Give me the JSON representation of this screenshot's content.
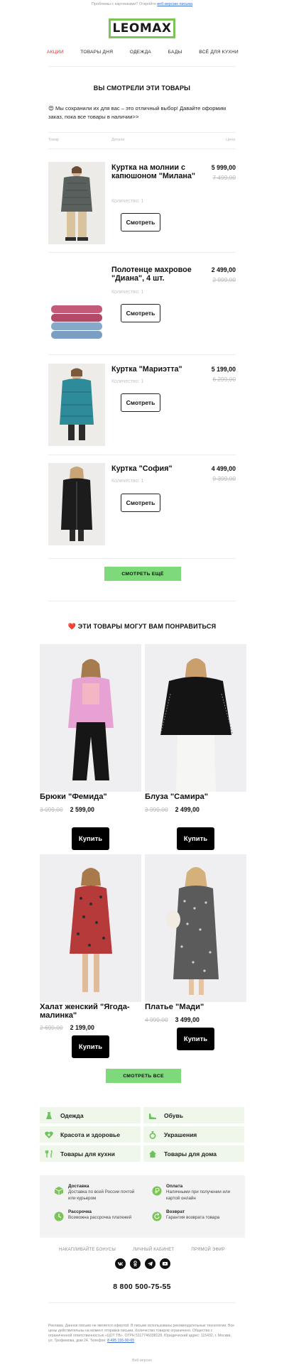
{
  "preheader": {
    "text": "Проблемы с картинками? Откройте",
    "link": "веб-версию письма"
  },
  "logo": {
    "text": "LEOMAX"
  },
  "nav": [
    {
      "label": "АКЦИИ",
      "active": true
    },
    {
      "label": "ТОВАРЫ ДНЯ"
    },
    {
      "label": "ОДЕЖДА"
    },
    {
      "label": "БАДЫ"
    },
    {
      "label": "ВСЁ ДЛЯ КУХНИ"
    }
  ],
  "viewed": {
    "title": "ВЫ СМОТРЕЛИ ЭТИ ТОВАРЫ",
    "intro_emoji": "😍",
    "intro": "Мы сохранили их для вас – это отличный выбор! Давайте оформим заказ, пока все товары в наличии>>",
    "columns": {
      "product": "Товар",
      "details": "Детали",
      "price": "Цена"
    },
    "items": [
      {
        "name": "Куртка на молнии с капюшоном \"Милана\"",
        "qty": "Количество: 1",
        "price": "5 999,00",
        "old_price": "7 499,00",
        "button": "Смотреть"
      },
      {
        "name": "Полотенце махровое \"Диана\", 4 шт.",
        "qty": "Количество: 1",
        "price": "2 499,00",
        "old_price": "2 999,00",
        "button": "Смотреть"
      },
      {
        "name": "Куртка \"Мариэтта\"",
        "qty": "Количество: 1",
        "price": "5 199,00",
        "old_price": "6 299,00",
        "button": "Смотреть"
      },
      {
        "name": "Куртка \"София\"",
        "qty": "Количество: 1",
        "price": "4 499,00",
        "old_price": "9 399,00",
        "button": "Смотреть"
      }
    ],
    "more_button": "СМОТРЕТЬ ЕЩЁ"
  },
  "recommend": {
    "title_emoji": "❤️",
    "title": "ЭТИ ТОВАРЫ МОГУТ ВАМ ПОНРАВИТЬСЯ",
    "items": [
      {
        "name": "Брюки \"Фемида\"",
        "old_price": "3 099,00",
        "price": "2 599,00",
        "button": "Купить"
      },
      {
        "name": "Блуза \"Самира\"",
        "old_price": "3 999,00",
        "price": "2 499,00",
        "button": "Купить"
      },
      {
        "name": "Халат женский \"Ягода-малинка\"",
        "old_price": "2 699,00",
        "price": "2 199,00",
        "button": "Купить"
      },
      {
        "name": "Платье \"Мади\"",
        "old_price": "4 999,00",
        "price": "3 499,00",
        "button": "Купить"
      }
    ],
    "all_button": "СМОТРЕТЬ ВСЕ"
  },
  "categories": [
    {
      "label": "Одежда",
      "icon": "dress-icon"
    },
    {
      "label": "Обувь",
      "icon": "shoe-icon"
    },
    {
      "label": "Красота и здоровье",
      "icon": "heart-plus-icon"
    },
    {
      "label": "Украшения",
      "icon": "ring-icon"
    },
    {
      "label": "Товары для кухни",
      "icon": "cutlery-icon"
    },
    {
      "label": "Товары для дома",
      "icon": "house-icon"
    }
  ],
  "info": [
    {
      "title": "Доставка",
      "desc": "Доставка по всей России почтой или курьером",
      "icon": "box-icon"
    },
    {
      "title": "Оплата",
      "desc": "Наличными при получении или картой онлайн",
      "icon": "ruble-icon"
    },
    {
      "title": "Рассрочка",
      "desc": "Возможна рассрочка платежей",
      "icon": "clock-icon"
    },
    {
      "title": "Возврат",
      "desc": "Гарантия возврата товара",
      "icon": "return-icon"
    }
  ],
  "footer": {
    "links": [
      "НАКАПЛИВАЙТЕ БОНУСЫ",
      "ЛИЧНЫЙ КАБИНЕТ",
      "ПРЯМОЙ ЭФИР"
    ],
    "social": [
      "vk-icon",
      "ok-icon",
      "telegram-icon",
      "youtube-icon"
    ],
    "phone": "8 800 500-75-55",
    "legal": "Реклама. Данное письмо не является офертой. В письме использованы рекомендательные технологии. Все цены действительны на момент отправки письма. Количество товаров ограничено. Общество с ограниченной ответственностью «ЦОТ ТВ». ОГРН 5117746038128. Юридический адрес: 115432, г. Москва, ул. Трофимова, дом 24. Телефон:",
    "legal_phone": "8 495 155-90-65",
    "web_version": "Веб-версия"
  },
  "colors": {
    "accent_green": "#7dd97a",
    "logo_green": "#7cc35a",
    "nav_active": "#e52b2b",
    "category_bg": "#eef7ea"
  }
}
